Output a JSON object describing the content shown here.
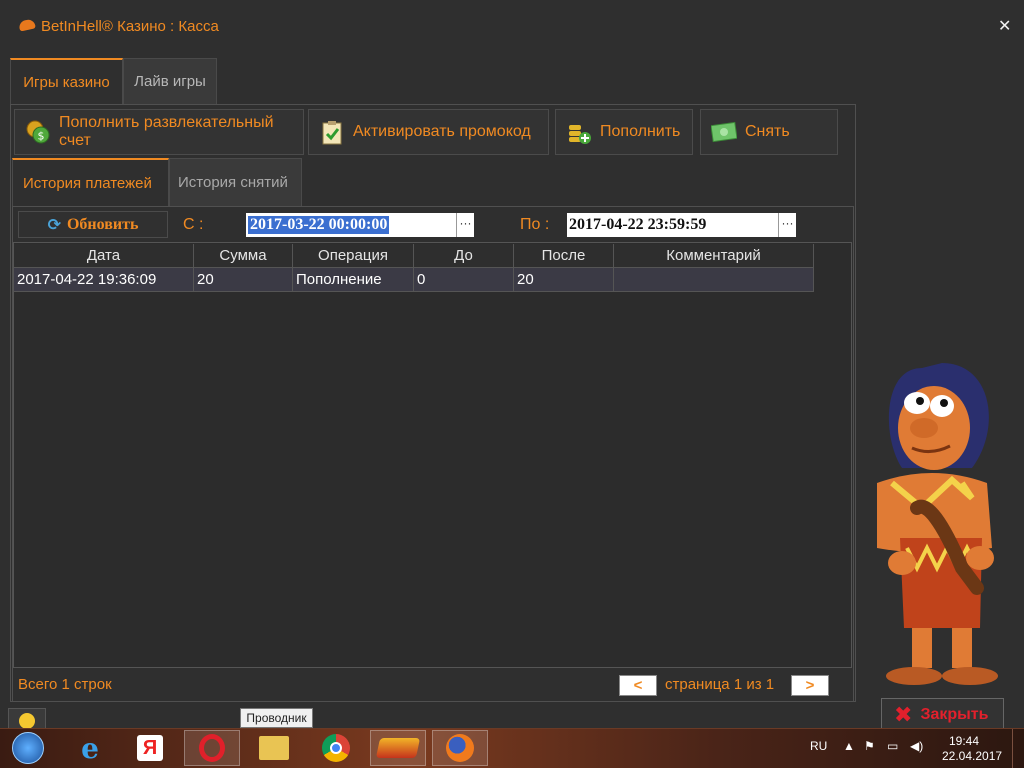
{
  "window": {
    "title": "BetInHell® Казино : Касса",
    "close_glyph": "✕"
  },
  "tabs": [
    {
      "label": "Игры казино"
    },
    {
      "label": "Лайв игры"
    }
  ],
  "actions": {
    "deposit_entertainment": "Пополнить развлекательный счет",
    "activate_promo": "Активировать промокод",
    "deposit": "Пополнить",
    "withdraw": "Снять"
  },
  "subtabs": [
    {
      "label": "История платежей"
    },
    {
      "label": "История снятий"
    }
  ],
  "filter": {
    "refresh": "Обновить",
    "from_label": "С :",
    "from_value": "2017-03-22 00:00:00",
    "to_label": "По :",
    "to_value": "2017-04-22 23:59:59",
    "picker": "···"
  },
  "table": {
    "headers": [
      "Дата",
      "Сумма",
      "Операция",
      "До",
      "После",
      "Комментарий"
    ],
    "rows": [
      [
        "2017-04-22 19:36:09",
        "20",
        "Пополнение",
        "0",
        "20",
        ""
      ]
    ]
  },
  "footer": {
    "total": "Всего 1 строк",
    "prev": "<",
    "page": "страница 1 из 1",
    "next": ">"
  },
  "close_button": "Закрыть",
  "tooltip": "Проводник",
  "taskbar": {
    "lang": "RU",
    "time": "19:44",
    "date": "22.04.2017"
  },
  "colors": {
    "accent": "#f08a22",
    "background": "#2f2f2f",
    "close_red": "#e3202c"
  }
}
